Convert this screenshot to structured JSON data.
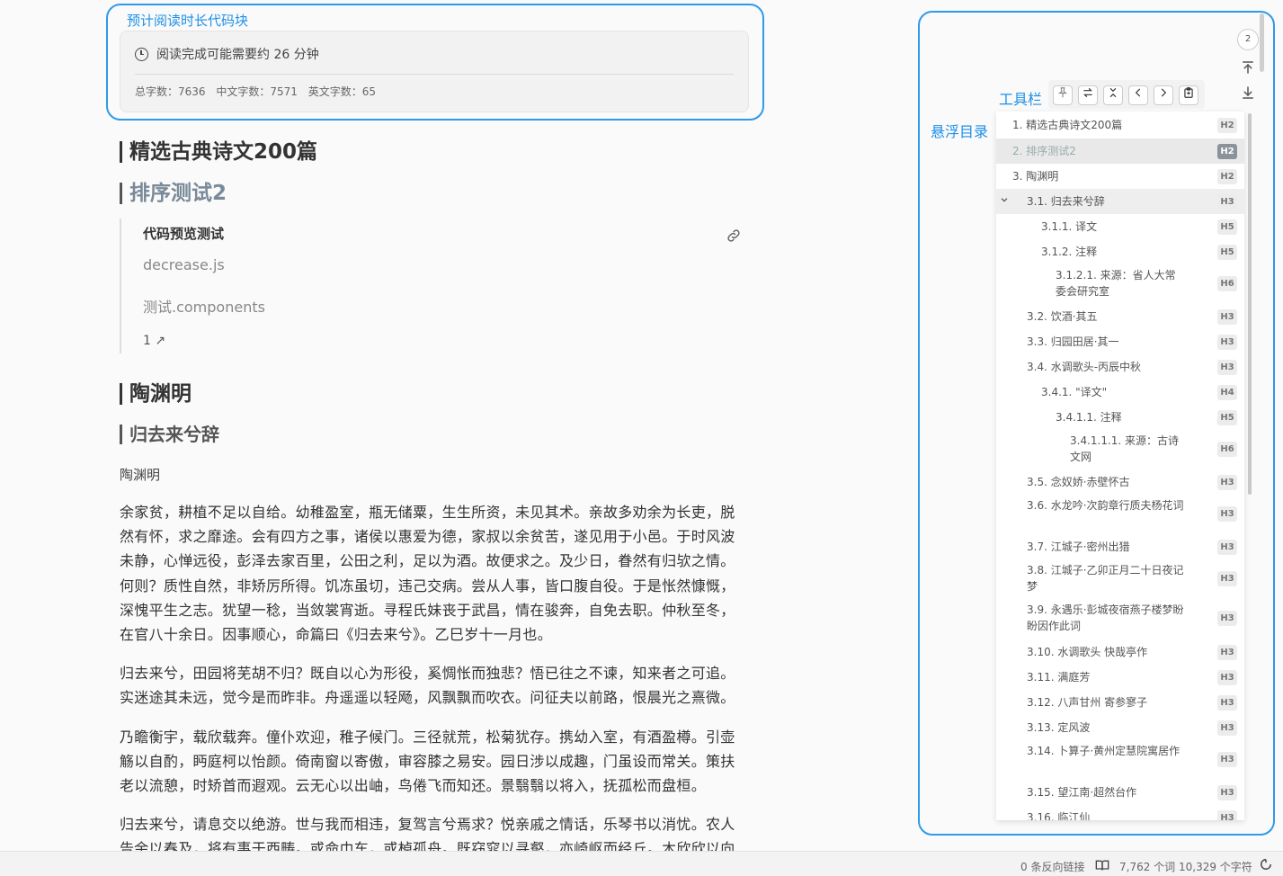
{
  "annotations": {
    "reading_time_block": "预计阅读时长代码块",
    "toolbar": "工具栏",
    "outline": "悬浮目录"
  },
  "reading": {
    "time_text": "阅读完成可能需要约 26 分钟",
    "total_words": "总字数：7636",
    "chinese_words": "中文字数：7571",
    "english_words": "英文字数：65"
  },
  "doc": {
    "h_selected": "精选古典诗文200篇",
    "h_sort_test": "排序测试2",
    "code_preview": {
      "title": "代码预览测试",
      "file1": "decrease.js",
      "file2": "测试.components",
      "count": "1 ↗"
    },
    "h_tao": "陶渊明",
    "h_gui": "归去来兮辞",
    "author": "陶渊明",
    "paragraphs": [
      "余家贫，耕植不足以自给。幼稚盈室，瓶无储粟，生生所资，未见其术。亲故多劝余为长吏，脱然有怀，求之靡途。会有四方之事，诸侯以惠爱为德，家叔以余贫苦，遂见用于小邑。于时风波未静，心惮远役，彭泽去家百里，公田之利，足以为酒。故便求之。及少日，眷然有归欤之情。何则？质性自然，非矫厉所得。饥冻虽切，违己交病。尝从人事，皆口腹自役。于是怅然慷慨，深愧平生之志。犹望一稔，当敛裳宵逝。寻程氏妹丧于武昌，情在骏奔，自免去职。仲秋至冬，在官八十余日。因事顺心，命篇曰《归去来兮》。乙巳岁十一月也。",
      "归去来兮，田园将芜胡不归？既自以心为形役，奚惆怅而独悲？悟已往之不谏，知来者之可追。实迷途其未远，觉今是而昨非。舟遥遥以轻飏，风飘飘而吹衣。问征夫以前路，恨晨光之熹微。",
      "乃瞻衡宇，载欣载奔。僮仆欢迎，稚子候门。三径就荒，松菊犹存。携幼入室，有酒盈樽。引壶觞以自酌，眄庭柯以怡颜。倚南窗以寄傲，审容膝之易安。园日涉以成趣，门虽设而常关。策扶老以流憩，时矫首而遐观。云无心以出岫，鸟倦飞而知还。景翳翳以将入，抚孤松而盘桓。",
      "归去来兮，请息交以绝游。世与我而相违，复驾言兮焉求？悦亲戚之情话，乐琴书以消忧。农人告余以春及，将有事于西畴。或命巾车，或棹孤舟。既窈窕以寻壑，亦崎岖而经丘。木欣欣以向荣，泉涓涓而始流。"
    ]
  },
  "side": {
    "count_badge": "2"
  },
  "toolbar": {
    "buttons": [
      "pin-icon",
      "swap-icon",
      "collapse-icon",
      "prev-icon",
      "next-icon",
      "clipboard-icon"
    ]
  },
  "toc": [
    {
      "text": "1. 精选古典诗文200篇",
      "badge": "H2"
    },
    {
      "text": "2. 排序测试2",
      "badge": "H2"
    },
    {
      "text": "3. 陶渊明",
      "badge": "H2"
    },
    {
      "text": "3.1. 归去来兮辞",
      "badge": "H3"
    },
    {
      "text": "3.1.1. 译文",
      "badge": "H5"
    },
    {
      "text": "3.1.2. 注释",
      "badge": "H5"
    },
    {
      "text": "3.1.2.1. 来源：省人大常委会研究室",
      "badge": "H6"
    },
    {
      "text": "3.2. 饮酒·其五",
      "badge": "H3"
    },
    {
      "text": "3.3. 归园田居·其一",
      "badge": "H3"
    },
    {
      "text": "3.4. 水调歌头-丙辰中秋",
      "badge": "H3"
    },
    {
      "text": "3.4.1. \"译文\"",
      "badge": "H4"
    },
    {
      "text": "3.4.1.1. 注释",
      "badge": "H5"
    },
    {
      "text": "3.4.1.1.1. 来源：古诗文网",
      "badge": "H6"
    },
    {
      "text": "3.5. 念奴娇·赤壁怀古",
      "badge": "H3"
    },
    {
      "text": "3.6. 水龙吟·次韵章行质夫杨花词",
      "badge": "H3"
    },
    {
      "text": "3.7. 江城子·密州出猎",
      "badge": "H3"
    },
    {
      "text": "3.8. 江城子·乙卯正月二十日夜记梦",
      "badge": "H3"
    },
    {
      "text": "3.9. 永遇乐·彭城夜宿燕子楼梦盼盼因作此词",
      "badge": "H3"
    },
    {
      "text": "3.10. 水调歌头 快哉亭作",
      "badge": "H3"
    },
    {
      "text": "3.11. 满庭芳",
      "badge": "H3"
    },
    {
      "text": "3.12. 八声甘州 寄参寥子",
      "badge": "H3"
    },
    {
      "text": "3.13. 定风波",
      "badge": "H3"
    },
    {
      "text": "3.14. 卜算子·黄州定慧院寓居作",
      "badge": "H3"
    },
    {
      "text": "3.15. 望江南·超然台作",
      "badge": "H3"
    },
    {
      "text": "3.16. 临江仙",
      "badge": "H3"
    }
  ],
  "status": {
    "backlinks": "0 条反向链接",
    "words": "7,762 个词",
    "chars": "10,329 个字符"
  }
}
